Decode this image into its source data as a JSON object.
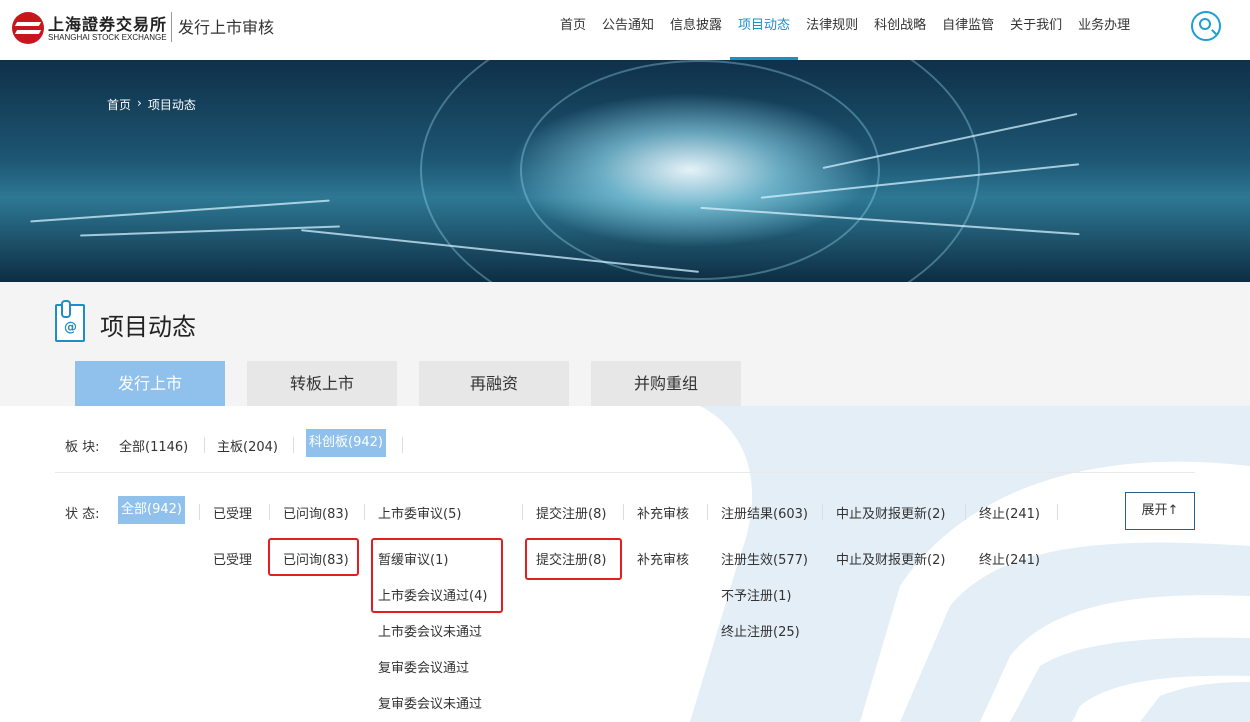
{
  "header": {
    "logo_cn": "上海證券交易所",
    "logo_en": "SHANGHAI STOCK EXCHANGE",
    "site_title": "发行上市审核",
    "nav": [
      {
        "label": "首页"
      },
      {
        "label": "公告通知"
      },
      {
        "label": "信息披露"
      },
      {
        "label": "项目动态"
      },
      {
        "label": "法律规则"
      },
      {
        "label": "科创战略"
      },
      {
        "label": "自律监管"
      },
      {
        "label": "关于我们"
      },
      {
        "label": "业务办理"
      }
    ],
    "active_nav": "项目动态",
    "search_icon": "search-icon"
  },
  "breadcrumb": {
    "home": "首页",
    "sep": "›",
    "current": "项目动态"
  },
  "page": {
    "title": "项目动态"
  },
  "tabs": [
    {
      "label": "发行上市",
      "active": true
    },
    {
      "label": "转板上市"
    },
    {
      "label": "再融资"
    },
    {
      "label": "并购重组"
    }
  ],
  "board": {
    "label": "板 块:",
    "options": [
      {
        "label": "全部(1146)"
      },
      {
        "label": "主板(204)"
      },
      {
        "label": "科创板(942)",
        "active": true
      }
    ]
  },
  "status": {
    "label": "状 态:",
    "all": "全部(942)",
    "row1": [
      "已受理",
      "已问询(83)",
      "上市委审议(5)",
      "提交注册(8)",
      "补充审核",
      "注册结果(603)",
      "中止及财报更新(2)",
      "终止(241)"
    ],
    "sub": {
      "accepted": "已受理",
      "inquired": "已问询(83)",
      "committee": [
        "暂缓审议(1)",
        "上市委会议通过(4)",
        "上市委会议未通过",
        "复审委会议通过",
        "复审委会议未通过"
      ],
      "submit": "提交注册(8)",
      "supplement": "补充审核",
      "result": [
        "注册生效(577)",
        "不予注册(1)",
        "终止注册(25)"
      ],
      "suspend": "中止及财报更新(2)",
      "terminate": "终止(241)"
    },
    "expand": "展开↑"
  },
  "colors": {
    "accent": "#1d8ec8",
    "chip": "#8fc1ec",
    "highlight": "#e02020"
  }
}
